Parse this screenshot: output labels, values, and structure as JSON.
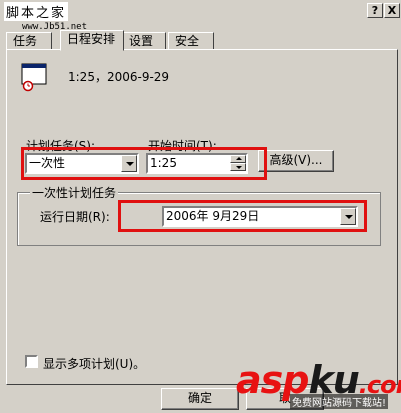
{
  "window": {
    "title": "脚本之家",
    "url_watermark": "www.Jb51.net",
    "help_btn": "?",
    "close_btn": "X"
  },
  "tabs": [
    {
      "label": "任务",
      "active": false
    },
    {
      "label": "日程安排",
      "active": true
    },
    {
      "label": "设置",
      "active": false
    },
    {
      "label": "安全",
      "active": false
    }
  ],
  "schedule": {
    "summary": "1:25，2006-9-29",
    "task_label": "计划任务(S):",
    "task_value": "一次性",
    "start_time_label": "开始时间(T):",
    "start_time_value": "1:25",
    "advanced_label": "高级(V)..."
  },
  "once_group": {
    "title": "一次性计划任务",
    "run_date_label": "运行日期(R):",
    "run_date_value": "2006年  9月29日"
  },
  "options": {
    "show_multiple_label": "显示多项计划(U)。"
  },
  "buttons": {
    "ok": "确定",
    "cancel": "取"
  },
  "branding": {
    "logo_part1": "asp",
    "logo_part2": "ku",
    "logo_part3": ".com",
    "logo_sub": "免费网站源码下载站!"
  },
  "colors": {
    "highlight_red": "#e01010",
    "face": "#d4d0c8"
  }
}
